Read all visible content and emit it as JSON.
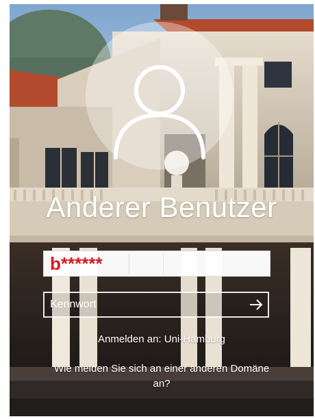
{
  "login": {
    "user_display_name": "Anderer Benutzer",
    "username_value": "b******",
    "password_placeholder": "Kennwort",
    "sign_in_to": "Anmelden an: Uni-Hamburg",
    "other_domain_link": "Wie melden Sie sich an einer anderen Domäne an?"
  },
  "icons": {
    "avatar": "user-silhouette-icon",
    "submit": "arrow-right-icon"
  },
  "colors": {
    "username_text": "#d71920",
    "foreground": "#ffffff"
  }
}
